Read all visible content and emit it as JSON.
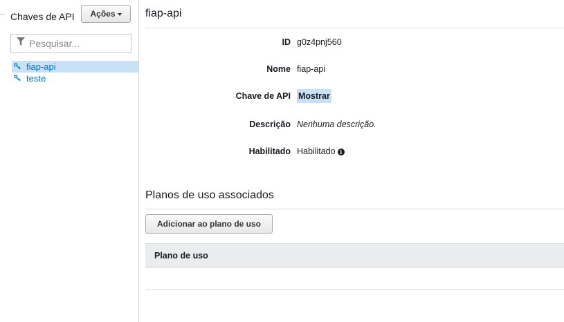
{
  "sidebar": {
    "title": "Chaves de API",
    "actions_label": "Ações",
    "search_placeholder": "Pesquisar...",
    "items": [
      {
        "label": "fiap-api",
        "selected": true
      },
      {
        "label": "teste",
        "selected": false
      }
    ]
  },
  "main": {
    "title": "fiap-api",
    "details": {
      "id_label": "ID",
      "id_value": "g0z4pnj560",
      "name_label": "Nome",
      "name_value": "fiap-api",
      "key_label": "Chave de API",
      "key_value": "Mostrar",
      "description_label": "Descrição",
      "description_value": "Nenhuma descrição.",
      "enabled_label": "Habilitado",
      "enabled_value": "Habilitado"
    },
    "usage_plans": {
      "title": "Planos de uso associados",
      "add_button": "Adicionar ao plano de uso",
      "column_header": "Plano de uso",
      "rows": []
    }
  },
  "colors": {
    "link": "#0073bb",
    "selected_bg": "#c9e1f7",
    "table_header_bg": "#eaeded"
  },
  "icons": {
    "filter": "filter-icon",
    "key": "key-icon",
    "info": "info-icon",
    "dropdown": "caret-down-icon"
  }
}
